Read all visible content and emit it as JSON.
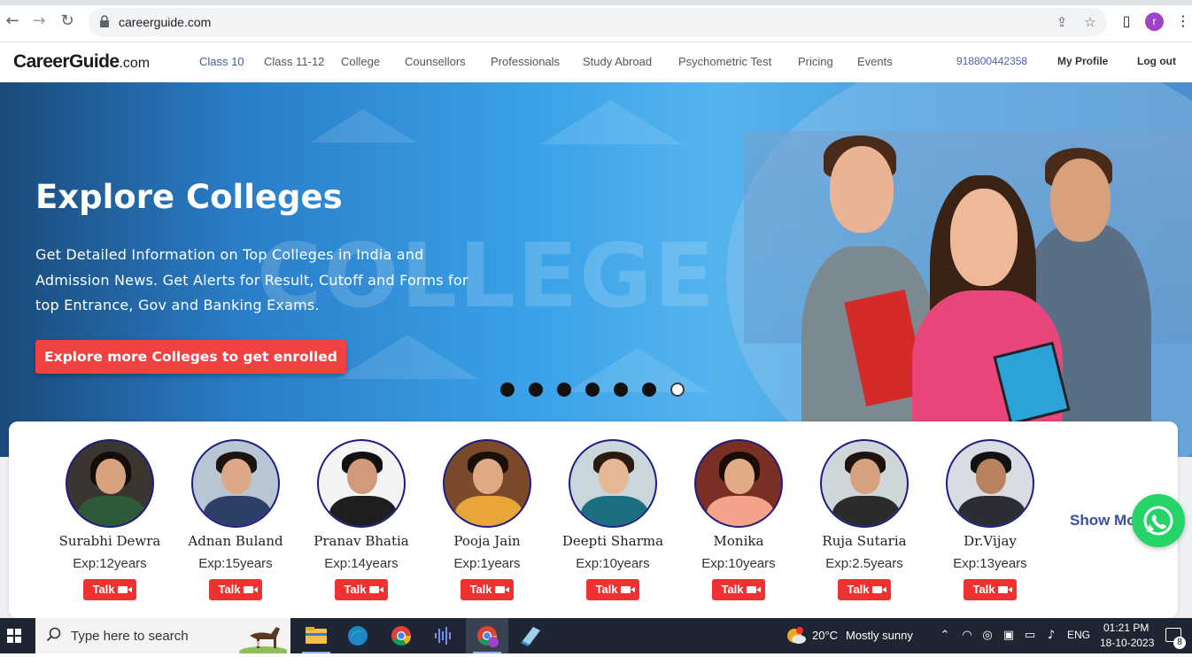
{
  "browser": {
    "url": "careerguide.com",
    "profile_initial": "r"
  },
  "site": {
    "logo_main": "CareerGuide",
    "logo_suffix": ".com",
    "nav": [
      {
        "label": "Class 10",
        "active": true
      },
      {
        "label": "Class 11-12"
      },
      {
        "label": "College"
      },
      {
        "label": "Counsellors"
      },
      {
        "label": "Professionals"
      },
      {
        "label": "Study Abroad"
      },
      {
        "label": "Psychometric Test"
      },
      {
        "label": "Pricing"
      },
      {
        "label": "Events"
      }
    ],
    "phone": "918800442358",
    "my_profile": "My Profile",
    "logout": "Log out"
  },
  "hero": {
    "background_word": "COLLEGE",
    "title": "Explore Colleges",
    "description": "Get Detailed Information on Top Colleges in India and Admission News. Get Alerts for Result, Cutoff and Forms for top Entrance, Gov and Banking Exams.",
    "cta": "Explore more Colleges to get enrolled",
    "slides_total": 7,
    "slide_active": 7
  },
  "counsellors": [
    {
      "name": "Surabhi Dewra",
      "exp": "Exp:12years",
      "talk": "Talk"
    },
    {
      "name": "Adnan Buland",
      "exp": "Exp:15years",
      "talk": "Talk"
    },
    {
      "name": "Pranav Bhatia",
      "exp": "Exp:14years",
      "talk": "Talk"
    },
    {
      "name": "Pooja Jain",
      "exp": "Exp:1years",
      "talk": "Talk"
    },
    {
      "name": "Deepti Sharma",
      "exp": "Exp:10years",
      "talk": "Talk"
    },
    {
      "name": "Monika",
      "exp": "Exp:10years",
      "talk": "Talk"
    },
    {
      "name": "Ruja Sutaria",
      "exp": "Exp:2.5years",
      "talk": "Talk"
    },
    {
      "name": "Dr.Vijay",
      "exp": "Exp:13years",
      "talk": "Talk"
    }
  ],
  "show_more": "Show More",
  "taskbar": {
    "search_placeholder": "Type here to search",
    "weather_temp": "20°C",
    "weather_desc": "Mostly sunny",
    "language": "ENG",
    "time": "01:21 PM",
    "date": "18-10-2023",
    "notifications": "8"
  },
  "colors": {
    "accent_red": "#f24141",
    "nav_active": "#3d5f9f",
    "whatsapp_green": "#25d366"
  }
}
